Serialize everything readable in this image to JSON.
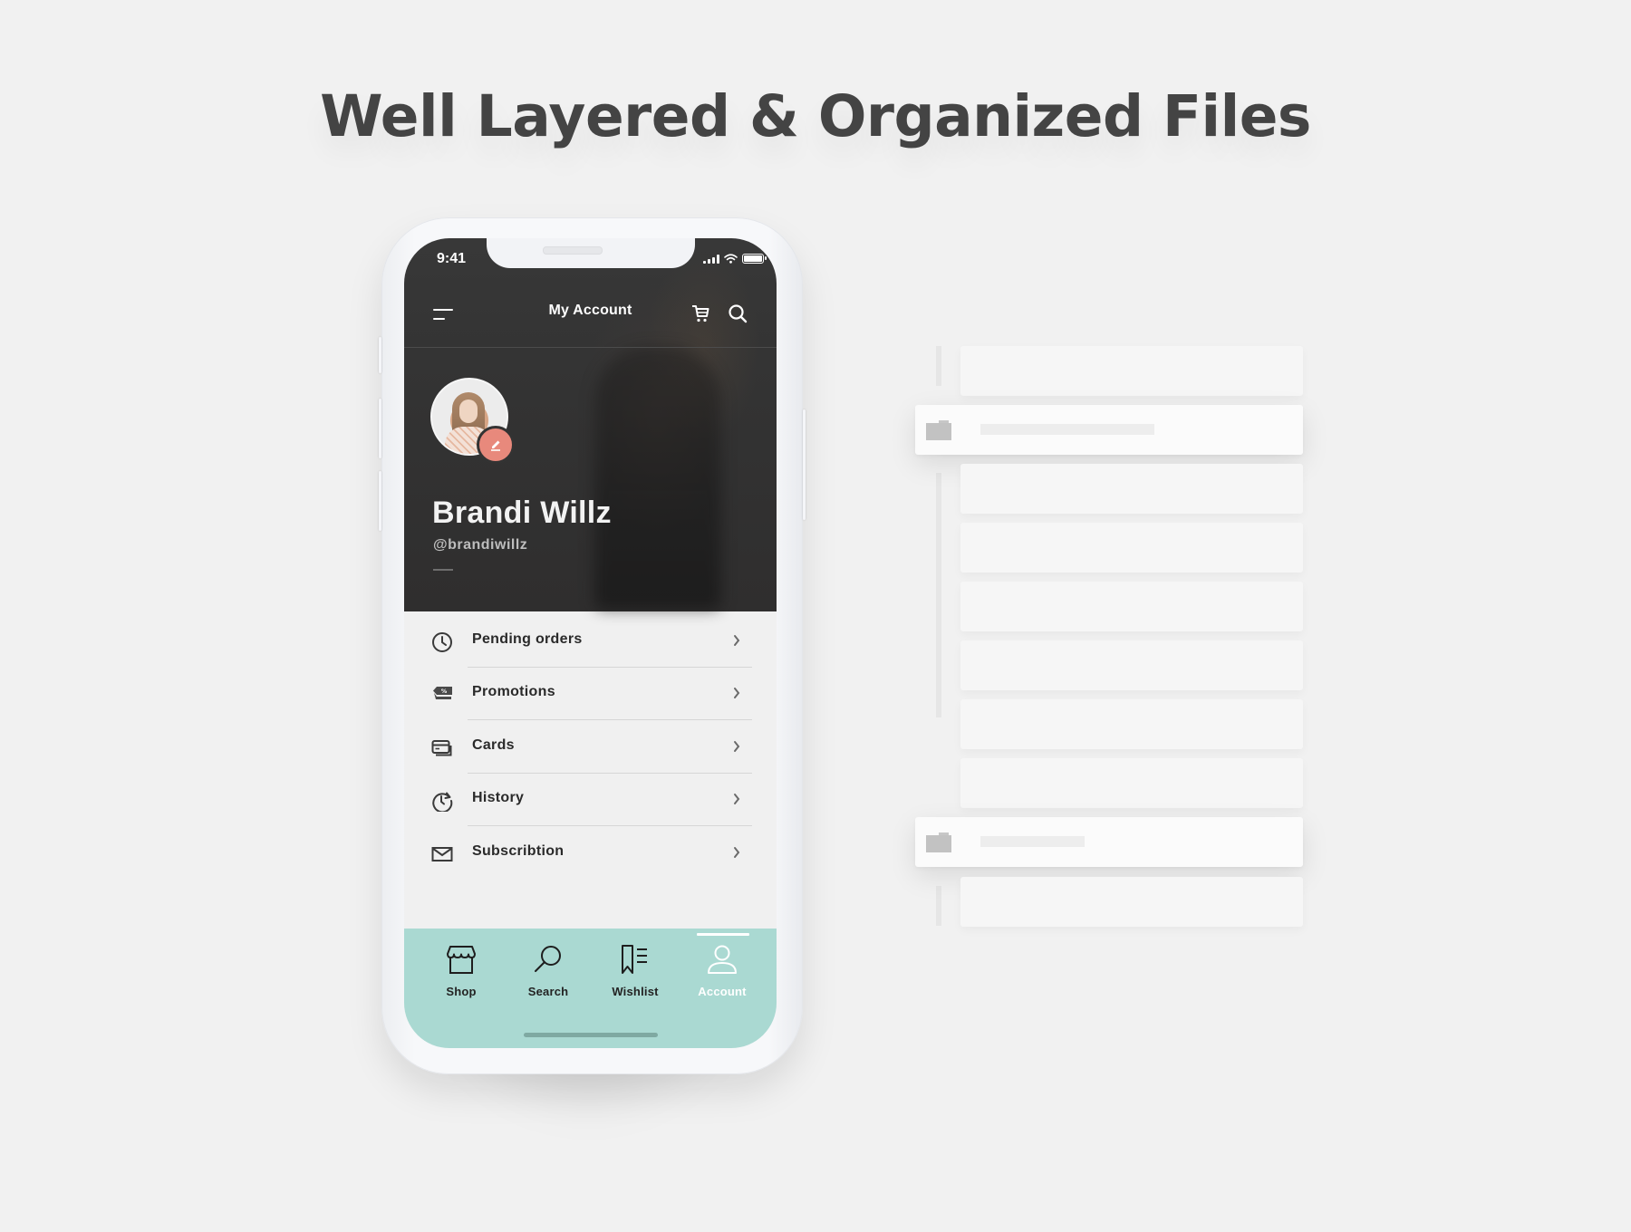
{
  "headline": "Well Layered & Organized Files",
  "phone": {
    "status_bar": {
      "time": "9:41"
    },
    "topbar": {
      "title": "My Account",
      "menu_icon": "menu-icon",
      "cart_icon": "cart-icon",
      "search_icon": "search-icon"
    },
    "profile": {
      "name": "Brandi Willz",
      "handle": "@brandiwillz",
      "edit_icon": "pencil-icon",
      "accent_color": "#e8897c"
    },
    "menu_items": [
      {
        "label": "Pending orders",
        "icon": "clock-icon"
      },
      {
        "label": "Promotions",
        "icon": "discount-tag-icon"
      },
      {
        "label": "Cards",
        "icon": "credit-cards-icon"
      },
      {
        "label": "History",
        "icon": "history-icon"
      },
      {
        "label": "Subscribtion",
        "icon": "envelope-icon"
      }
    ],
    "tabbar": {
      "background_color": "#aad9d2",
      "active_tab": "Account",
      "tabs": [
        {
          "label": "Shop",
          "icon": "store-icon"
        },
        {
          "label": "Search",
          "icon": "search-icon"
        },
        {
          "label": "Wishlist",
          "icon": "bookmark-list-icon"
        },
        {
          "label": "Account",
          "icon": "user-icon"
        }
      ]
    }
  },
  "layers_panel": {
    "rows": [
      {
        "type": "layer"
      },
      {
        "type": "folder",
        "icon": "folder-icon"
      },
      {
        "type": "layer"
      },
      {
        "type": "layer"
      },
      {
        "type": "layer"
      },
      {
        "type": "layer"
      },
      {
        "type": "layer"
      },
      {
        "type": "layer"
      },
      {
        "type": "folder",
        "icon": "folder-icon"
      },
      {
        "type": "layer"
      }
    ]
  }
}
